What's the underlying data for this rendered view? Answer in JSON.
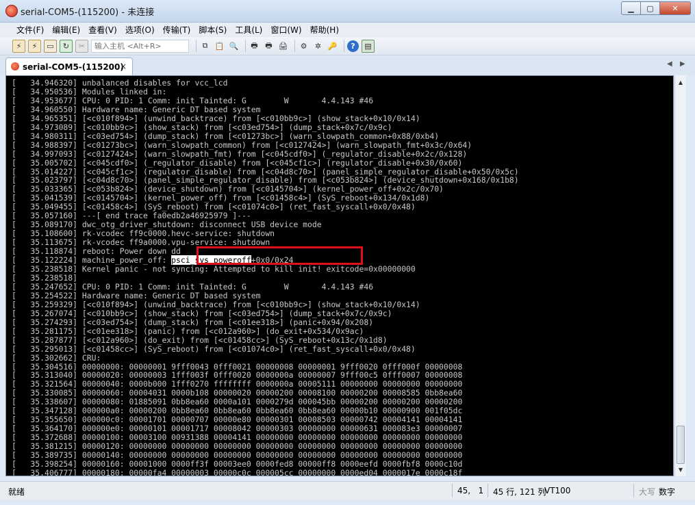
{
  "window": {
    "title": "serial-COM5-(115200) - 未连接"
  },
  "menu": [
    "文件(F)",
    "编辑(E)",
    "查看(V)",
    "选项(O)",
    "传输(T)",
    "脚本(S)",
    "工具(L)",
    "窗口(W)",
    "帮助(H)"
  ],
  "toolbar": {
    "host_placeholder": "输入主机 <Alt+R>"
  },
  "tab": {
    "label": "serial-COM5-(115200)",
    "close": "×"
  },
  "terminal": {
    "lines": [
      "[   34.946320] unbalanced disables for vcc_lcd",
      "[   34.950536] Modules linked in:",
      "[   34.953677] CPU: 0 PID: 1 Comm: init Tainted: G        W       4.4.143 #46",
      "[   34.960550] Hardware name: Generic DT based system",
      "[   34.965351] [<c010f894>] (unwind_backtrace) from [<c010bb9c>] (show_stack+0x10/0x14)",
      "[   34.973089] [<c010bb9c>] (show_stack) from [<c03ed754>] (dump_stack+0x7c/0x9c)",
      "[   34.980311] [<c03ed754>] (dump_stack) from [<c01273bc>] (warn_slowpath_common+0x88/0xb4)",
      "[   34.988397] [<c01273bc>] (warn_slowpath_common) from [<c0127424>] (warn_slowpath_fmt+0x3c/0x64)",
      "[   34.997093] [<c0127424>] (warn_slowpath_fmt) from [<c045cdf0>] (_regulator_disable+0x2c/0x128)",
      "[   35.005702] [<c045cdf0>] (_regulator_disable) from [<c045cf1c>] (regulator_disable+0x30/0x60)",
      "[   35.014227] [<c045cf1c>] (regulator_disable) from [<c04d8c70>] (panel_simple_regulator_disable+0x50/0x5c)",
      "[   35.023797] [<c04d8c70>] (panel_simple_regulator_disable) from [<c053b824>] (device_shutdown+0x168/0x1b8)",
      "[   35.033365] [<c053b824>] (device_shutdown) from [<c0145704>] (kernel_power_off+0x2c/0x70)",
      "[   35.041539] [<c0145704>] (kernel_power_off) from [<c01458c4>] (SyS_reboot+0x134/0x1d8)",
      "[   35.049455] [<c01458c4>] (SyS_reboot) from [<c01074c0>] (ret_fast_syscall+0x0/0x48)",
      "[   35.057160] ---[ end trace fa0edb2a46925979 ]---",
      "[   35.089170] dwc_otg_driver_shutdown: disconnect USB device mode",
      "[   35.108600] rk-vcodec ff9c0000.hevc-service: shutdown",
      "[   35.113675] rk-vcodec ff9a0000.vpu-service: shutdown",
      "[   35.118874] reboot: Power down dd",
      "[   35.122224] machine_power_off: psci_sys_poweroff+0x0/0x24",
      "[   35.238518] Kernel panic - not syncing: Attempted to kill init! exitcode=0x00000000",
      "[   35.238518]",
      "[   35.247652] CPU: 0 PID: 1 Comm: init Tainted: G        W       4.4.143 #46",
      "[   35.254522] Hardware name: Generic DT based system",
      "[   35.259329] [<c010f894>] (unwind_backtrace) from [<c010bb9c>] (show_stack+0x10/0x14)",
      "[   35.267074] [<c010bb9c>] (show_stack) from [<c03ed754>] (dump_stack+0x7c/0x9c)",
      "[   35.274293] [<c03ed754>] (dump_stack) from [<c01ee318>] (panic+0x94/0x208)",
      "[   35.281175] [<c01ee318>] (panic) from [<c012a960>] (do_exit+0x534/0x9ac)",
      "[   35.287877] [<c012a960>] (do_exit) from [<c01458cc>] (SyS_reboot+0x13c/0x1d8)",
      "[   35.295013] [<c01458cc>] (SyS_reboot) from [<c01074c0>] (ret_fast_syscall+0x0/0x48)",
      "[   35.302662] CRU:",
      "[   35.304516] 00000000: 00000001 9fff0043 0fff0021 00000008 00000001 9fff0020 0fff000f 00000008",
      "[   35.313040] 00000020: 00000003 1fff003f 0fff0020 0000000a 00000007 9fff00c5 0fff0007 00000008",
      "[   35.321564] 00000040: 0000b000 1fff0270 ffffffff 0000000a 00005111 00000000 00000000 00000000",
      "[   35.330085] 00000060: 00004031 0000b108 00000020 00000200 00008100 00000200 00008585 0bb8ea60",
      "[   35.338607] 00000080: 01885091 0bb8ea60 0000a101 0000279d 000045bb 00000200 00000200 00000200",
      "[   35.347128] 000000a0: 00000200 0bb8ea60 0bb8ea60 0bb8ea60 0bb8ea60 00000b10 00000900 001f05dc",
      "[   35.355650] 000000c0: 00001701 00000707 00000e80 00000301 00008503 00000742 00004141 00004141",
      "[   35.364170] 000000e0: 00000101 00001717 00008042 00000303 00000000 00000631 000083e3 00000007",
      "[   35.372688] 00000100: 00003100 00931388 00004141 00000000 00000000 00000000 00000000 00000000",
      "[   35.381215] 00000120: 00000000 00000000 00000000 00000000 00000000 00000000 00000000 00000000",
      "[   35.389735] 00000140: 00000000 00000000 00000000 00000000 00000000 00000000 00000000 00000000",
      "[   35.398254] 00000160: 00001000 0000ff3f 00003ee0 0000fed8 00000ff8 0000eefd 0000fbf8 0000c10d",
      "[   35.406777] 00000180: 00000fa4 00000003 00000c0c 000005cc 00000000 0000ed04 0000017e 0000c18f"
    ],
    "highlight_line_index": 20,
    "highlight_prefix": "[   35.122224] machine_power_off: ",
    "highlight_text": "psci_sys_poweroff",
    "highlight_suffix": "+0x0/0x24"
  },
  "statusbar": {
    "ready": "就绪",
    "cursor_pos": "45,   1",
    "size": "45 行, 121 列",
    "term_type": "VT100",
    "caps": "大写",
    "num": "数字"
  }
}
